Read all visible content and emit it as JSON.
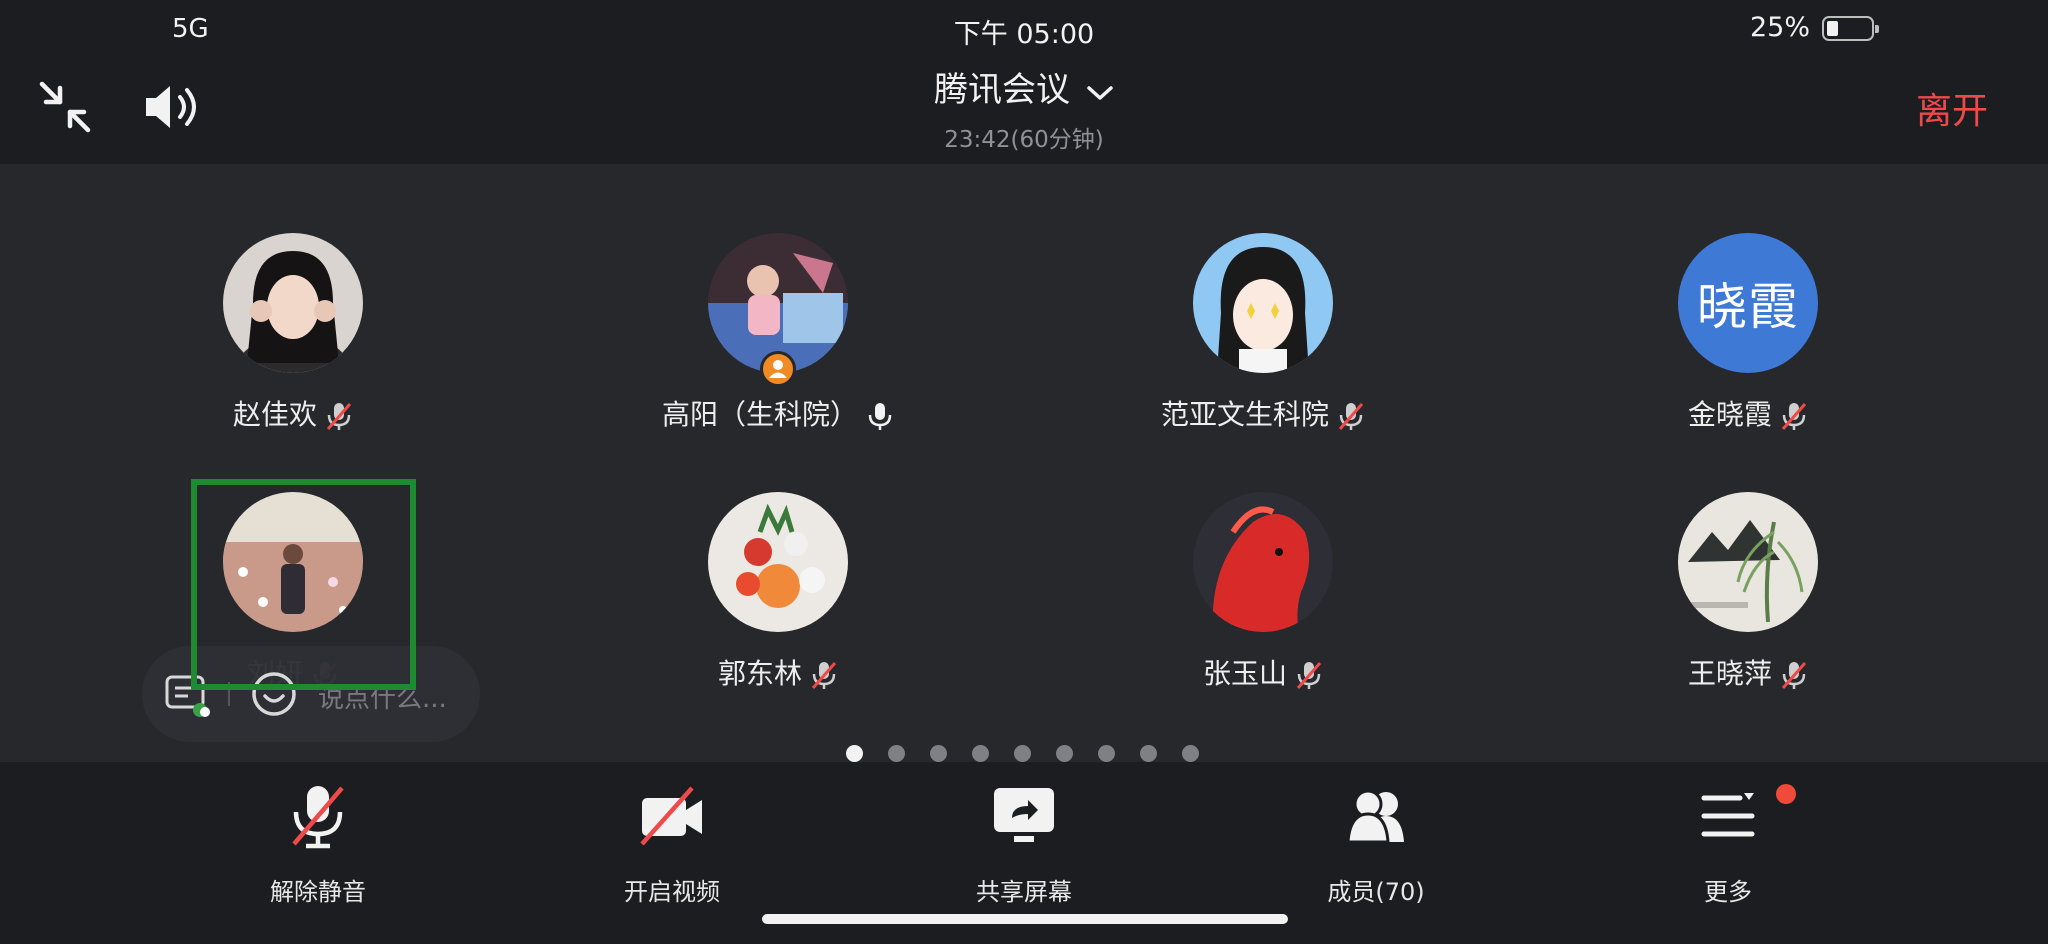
{
  "status_bar": {
    "network": "5G",
    "time": "下午 05:00",
    "battery_text": "25%",
    "battery_level": 0.25
  },
  "header": {
    "title": "腾讯会议",
    "subtitle": "23:42(60分钟)",
    "leave_label": "离开"
  },
  "participants": [
    {
      "name": "赵佳欢",
      "mic": "muted",
      "avatar": "photo-girl"
    },
    {
      "name": "高阳（生科院）",
      "mic": "on",
      "avatar": "photo-child",
      "host": true
    },
    {
      "name": "范亚文生科院",
      "mic": "muted",
      "avatar": "cartoon-girl"
    },
    {
      "name": "金晓霞",
      "mic": "muted",
      "avatar": "text",
      "avatar_text": "晓霞",
      "avatar_color": "#3e79d6"
    },
    {
      "name": "刘妍",
      "mic": "muted",
      "avatar": "photo-flowers-field"
    },
    {
      "name": "郭东林",
      "mic": "muted",
      "avatar": "photo-bouquet"
    },
    {
      "name": "张玉山",
      "mic": "muted",
      "avatar": "photo-red-horse"
    },
    {
      "name": "王晓萍",
      "mic": "muted",
      "avatar": "ink-painting"
    }
  ],
  "chat": {
    "placeholder": "说点什么..."
  },
  "pagination": {
    "pages": 9,
    "current": 1
  },
  "toolbar": {
    "unmute": "解除静音",
    "video": "开启视频",
    "share": "共享屏幕",
    "members": "成员(70)",
    "more": "更多"
  },
  "colors": {
    "accent_red": "#ef4a4a",
    "badge_red": "#f14a3a",
    "highlight_green": "#1f8a2f"
  }
}
